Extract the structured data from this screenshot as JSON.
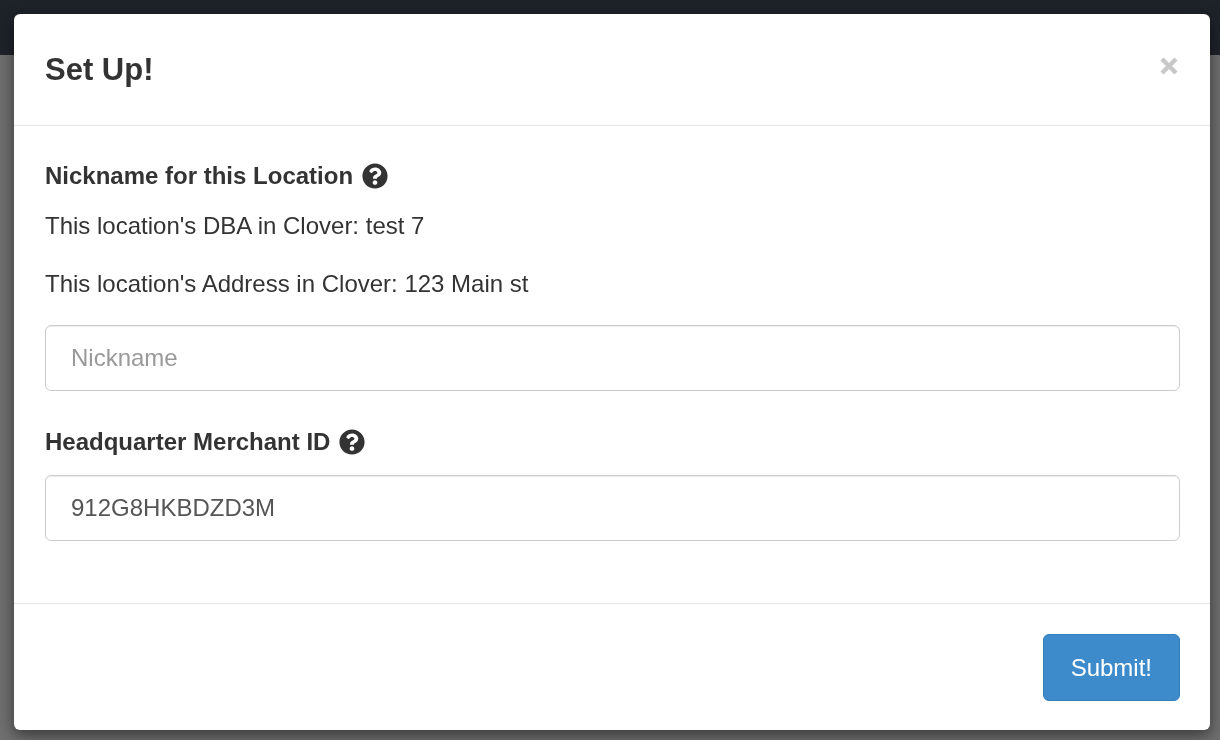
{
  "modal": {
    "title": "Set Up!",
    "body": [
      {
        "kind": "label",
        "text": "Nickname for this Location",
        "help": true
      },
      {
        "kind": "text",
        "text": "This location's DBA in Clover: test 7"
      },
      {
        "kind": "text",
        "text": "This location's Address in Clover: 123 Main st"
      },
      {
        "kind": "input",
        "placeholder": "Nickname"
      },
      {
        "kind": "label",
        "text": "Headquarter Merchant ID",
        "help": true
      },
      {
        "kind": "input",
        "value": "912G8HKBDZD3M"
      }
    ],
    "footer": {
      "buttons": [
        {
          "label": "Submit!"
        }
      ]
    }
  }
}
